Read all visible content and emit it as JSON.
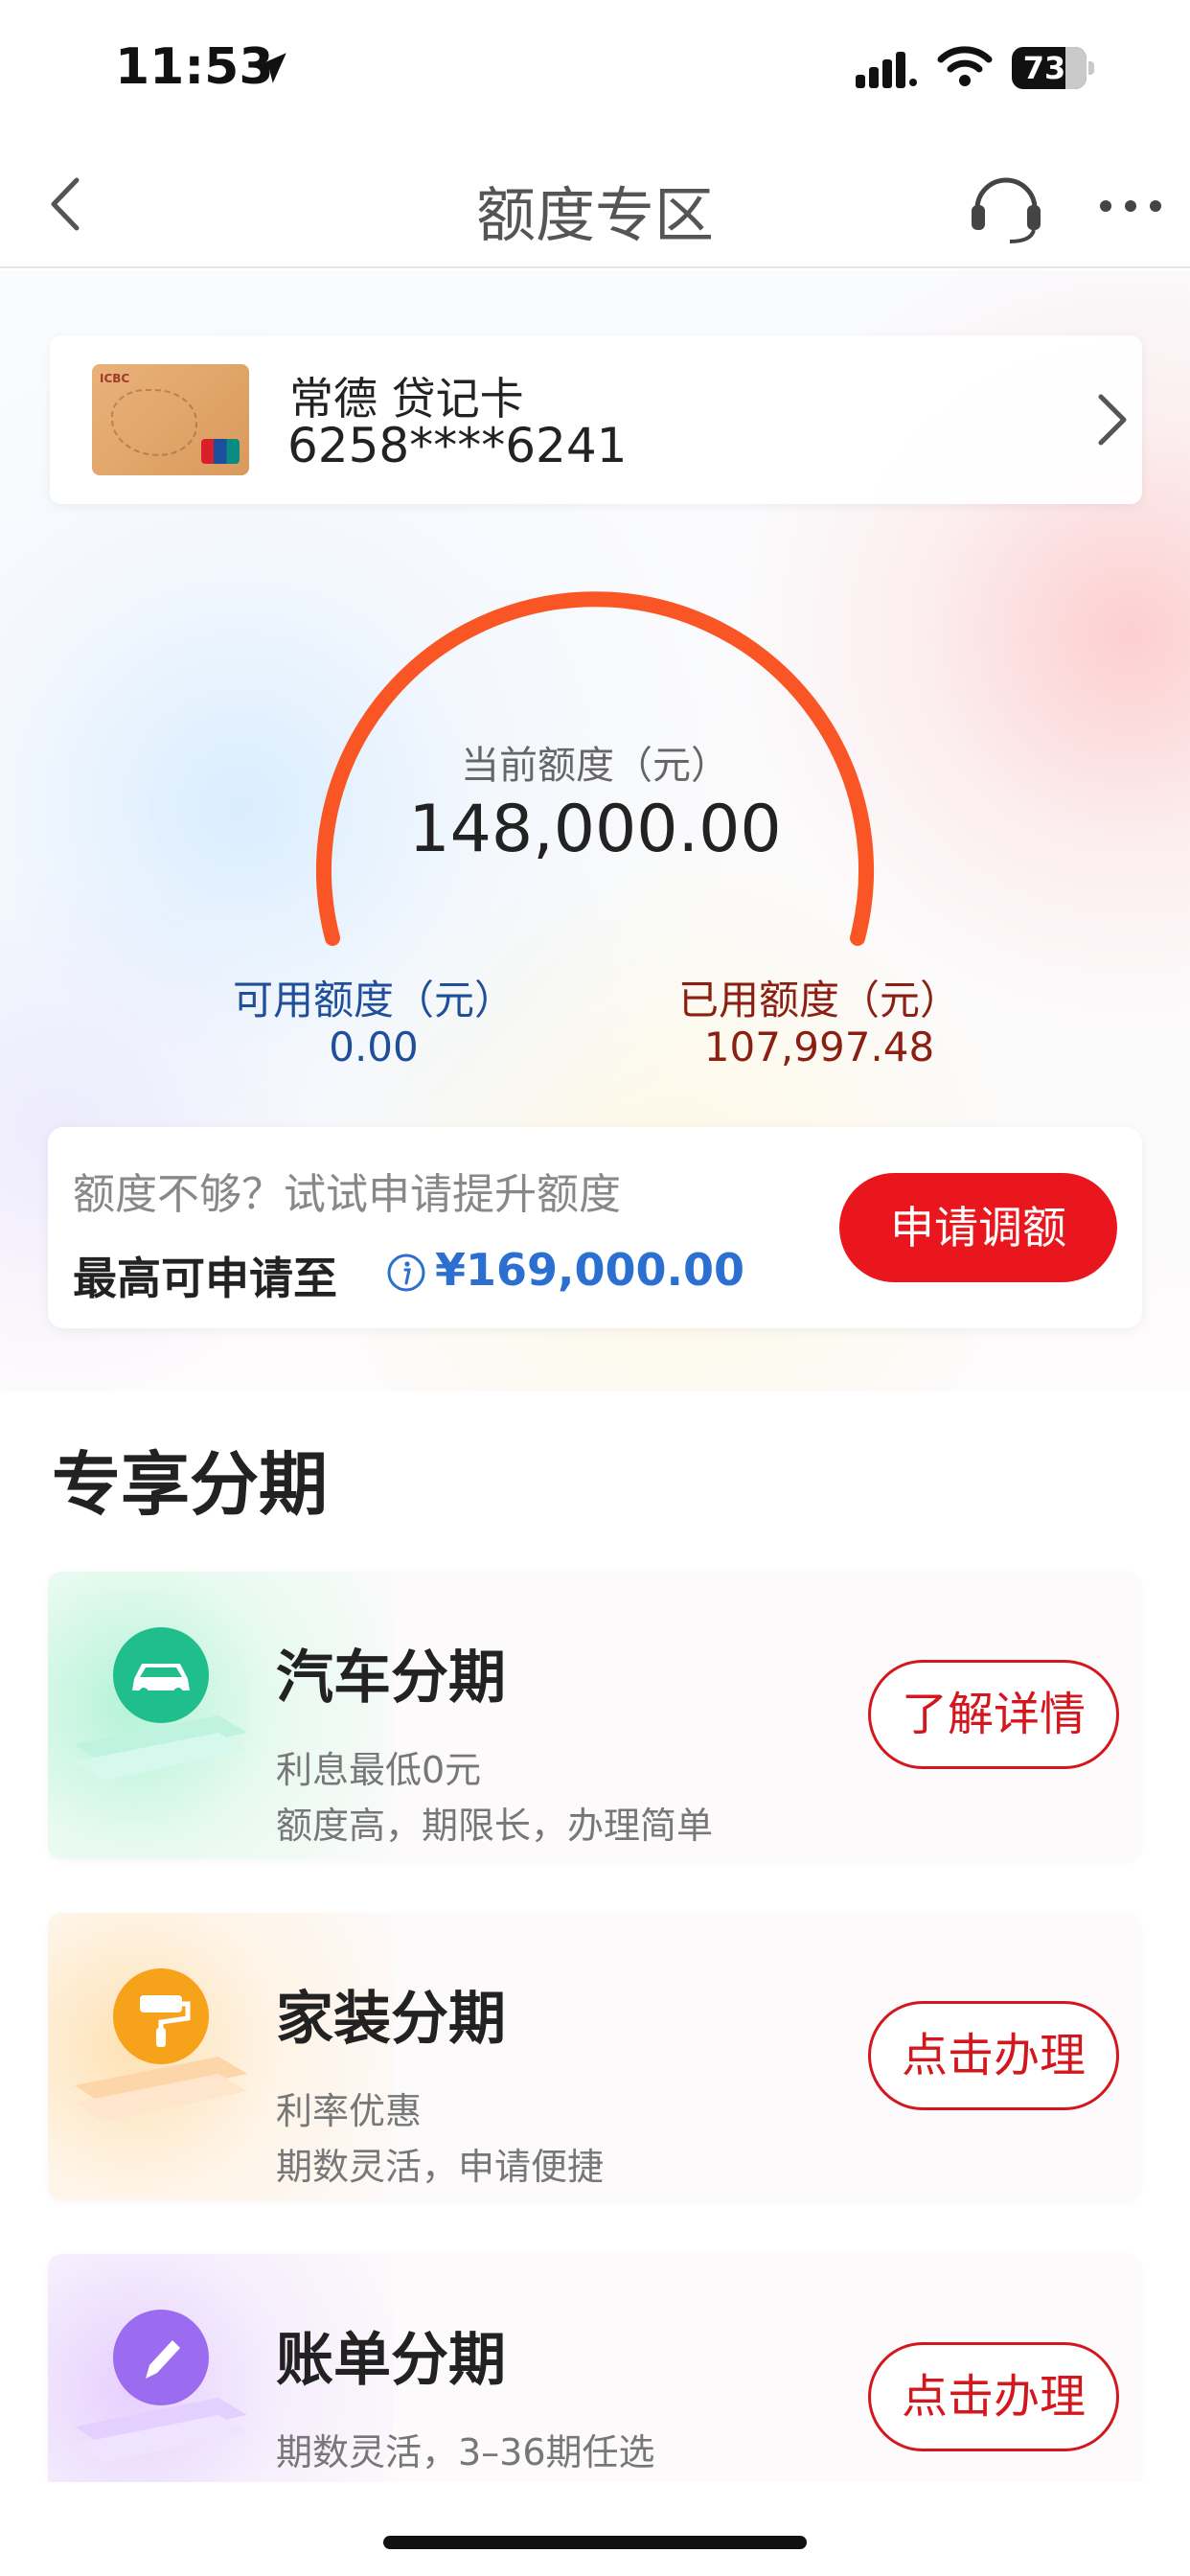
{
  "status_bar": {
    "time": "11:53",
    "battery": "73"
  },
  "nav": {
    "title": "额度专区"
  },
  "card": {
    "name": "常德 贷记卡",
    "number": "6258****6241"
  },
  "credit": {
    "current_label": "当前额度（元）",
    "current_value": "148,000.00",
    "available_label": "可用额度（元）",
    "available_value": "0.00",
    "used_label": "已用额度（元）",
    "used_value": "107,997.48",
    "gauge_color": "#fa5525"
  },
  "limit": {
    "hint": "额度不够？试试申请提升额度",
    "max_label": "最高可申请至",
    "max_value": "¥169,000.00",
    "apply_button": "申请调额"
  },
  "installments": {
    "section_title": "专享分期",
    "items": [
      {
        "title": "汽车分期",
        "desc1": "利息最低0元",
        "desc2": "额度高，期限长，办理简单",
        "button": "了解详情",
        "icon": "car-icon",
        "color": "#1fbe8c"
      },
      {
        "title": "家装分期",
        "desc1": "利率优惠",
        "desc2": "期数灵活，申请便捷",
        "button": "点击办理",
        "icon": "paint-roller-icon",
        "color": "#f7a21b"
      },
      {
        "title": "账单分期",
        "desc1": "期数灵活，3–36期任选",
        "desc2": "",
        "button": "点击办理",
        "icon": "pencil-icon",
        "color": "#9b6cf0"
      }
    ]
  },
  "colors": {
    "accent_red": "#e9161d",
    "link_blue": "#2b6fd1"
  }
}
